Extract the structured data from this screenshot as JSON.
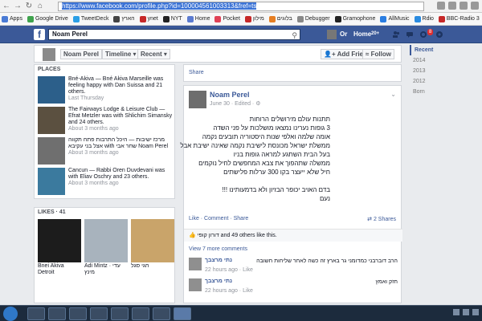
{
  "browser": {
    "url_selected": "https://www.facebook.com/profile.php?id=100004561003313&fref=ts",
    "bookmarks": [
      {
        "label": "Apps",
        "color": "#4a7bd5"
      },
      {
        "label": "Google Drive",
        "color": "#3fa34d"
      },
      {
        "label": "TweetDeck",
        "color": "#2b9fe6"
      },
      {
        "label": "הארץ",
        "color": "#444444"
      },
      {
        "label": "ynet",
        "color": "#c62828"
      },
      {
        "label": "NYT",
        "color": "#222222"
      },
      {
        "label": "Home",
        "color": "#5b7bd0"
      },
      {
        "label": "Pocket",
        "color": "#e04155"
      },
      {
        "label": "מילון",
        "color": "#c62828"
      },
      {
        "label": "בלוגים",
        "color": "#e67e22"
      },
      {
        "label": "Debugger",
        "color": "#888888"
      },
      {
        "label": "Gramophone",
        "color": "#222222"
      },
      {
        "label": "AllMusic",
        "color": "#2a7de1"
      },
      {
        "label": "Rdio",
        "color": "#2a8be0"
      },
      {
        "label": "BBC-Radio 3",
        "color": "#c62828"
      }
    ]
  },
  "fb": {
    "search_value": "Noam Perel",
    "user_short": "Or",
    "home_label": "Home",
    "home_badge": "20+",
    "notif_count": "8"
  },
  "timeline": {
    "name_btn": "Noam Perel",
    "timeline_btn": "Timeline ▾",
    "recent_btn": "Recent ▾",
    "add_friend": "Add Friend",
    "follow": "Follow",
    "years": [
      "Recent",
      "2014",
      "2013",
      "2012",
      "Born"
    ]
  },
  "places": {
    "header": "PLACES",
    "items": [
      {
        "text": "Bné-Akiva — Bné Akiva Marseille was feeling happy with Dan Suissa and 21 others.",
        "time": "Last Thursday"
      },
      {
        "text": "The Fairways Lodge & Leisure Club — Efrat Metzler was with Shlichim Simansky and 24 others.",
        "time": "About 3 months ago"
      },
      {
        "text": "מרכז ישיבות — היכל התרבות פתח תקווה אצל בני עקיבא with שחר אבי Noam Perel",
        "time": "About 3 months ago"
      },
      {
        "text": "Cancun — Rabbi Oren Duvdevani was with Eliav Oschry and 23 others.",
        "time": "About 3 months ago"
      }
    ]
  },
  "likes": {
    "header": "LIKES · 41",
    "items": [
      {
        "label": "Bnei Akiva Detroit"
      },
      {
        "label": "Adi Mintz · עדי מינץ"
      },
      {
        "label": "חגי סגל"
      }
    ]
  },
  "share_top": "Share",
  "post": {
    "author": "Noam Perel",
    "meta": "June 30 · Edited · ⚙",
    "lines": [
      "תתנות עולם מירושלים הרוחות",
      "3 גופות נערינו נמצאו מושלכות על פני השדה",
      "אומה שלמה ואלפי שנות היסטוריה תובעים נקמה",
      "ממשלת ישראל מכונסת לישיבת נקמה שאינה ישיבת אבל",
      "בעל הבית השתגע למראה גופות בניו",
      "ממשלה שתהפוך את צבא המחפשים לחיל נוקמים",
      "חיל שלא ייעצר בקו 300 ערלות פלישתים",
      "",
      "בדם האויב יכופר הבזיון ולא בדמעותינו !!!",
      "נעם"
    ],
    "actions": "Like · Comment · Share",
    "shares": "2 Shares",
    "likes_line": "דורון קופי and 49 others like this.",
    "view_more": "View 7 more comments",
    "comments": [
      {
        "name": "נתי מרצבך",
        "text": "הרב דוברבני כמדומני גר בארץ זה כשה לאחר שליחות חשובה",
        "time": "22 hours ago · Like"
      },
      {
        "name": "נתי מרצבך",
        "text": "חזק ואמץ",
        "time": "22 hours ago · Like"
      }
    ]
  },
  "colors": {
    "fb_blue": "#3b5998",
    "link": "#3b5998",
    "page_bg": "#e9ebee"
  }
}
